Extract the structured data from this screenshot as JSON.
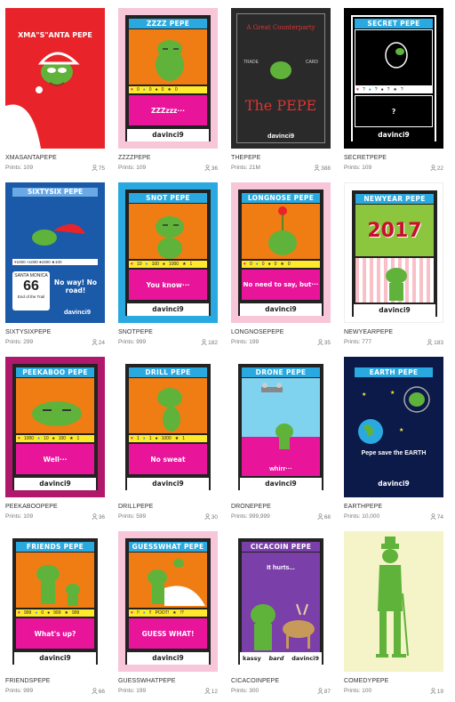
{
  "cards": [
    {
      "name": "XMASANTAPEPE",
      "prints": "Prints: 109",
      "owners": "75",
      "title": "XMA\"S\"ANTA PEPE",
      "desc": "",
      "stats": [],
      "footer": ""
    },
    {
      "name": "ZZZZPEPE",
      "prints": "Prints: 109",
      "owners": "36",
      "title": "ZZZZ PEPE",
      "desc": "ZZZzzz···",
      "stats": [
        "0",
        "0",
        "0",
        "0"
      ],
      "footer": "davinci9"
    },
    {
      "name": "THEPEPE",
      "prints": "Prints: 21M",
      "owners": "388",
      "title": "A Great Counterparty",
      "desc": "The PEPE",
      "stats": [
        "TRADE",
        "CARD"
      ],
      "footer": "davinci9"
    },
    {
      "name": "SECRETPEPE",
      "prints": "Prints: 109",
      "owners": "22",
      "title": "SECRET PEPE",
      "desc": "?",
      "stats": [
        "?",
        "?",
        "?",
        "?"
      ],
      "footer": "davinci9"
    },
    {
      "name": "SIXTYSIXPEPE",
      "prints": "Prints: 299",
      "owners": "24",
      "title": "SIXTYSIX PEPE",
      "desc": "No way! No road!",
      "stats": [
        "1000",
        "1000",
        "1000",
        "100"
      ],
      "footer": "davinci9",
      "sign_top": "SANTA MONICA",
      "sign_num": "66",
      "sign_bottom": "End of the Trail"
    },
    {
      "name": "SNOTPEPE",
      "prints": "Prints: 999",
      "owners": "182",
      "title": "SNOT PEPE",
      "desc": "You know···",
      "stats": [
        "10",
        "100",
        "1000",
        "1"
      ],
      "footer": "davinci9"
    },
    {
      "name": "LONGNOSEPEPE",
      "prints": "Prints: 199",
      "owners": "35",
      "title": "LONGNOSE PEPE",
      "desc": "No need to say, but···",
      "stats": [
        "0",
        "0",
        "0",
        "0"
      ],
      "footer": "davinci9"
    },
    {
      "name": "NEWYEARPEPE",
      "prints": "Prints: 777",
      "owners": "183",
      "title": "NEWYEAR PEPE",
      "desc": "2017",
      "stats": [],
      "footer": "davinci9"
    },
    {
      "name": "PEEKABOOPEPE",
      "prints": "Prints: 109",
      "owners": "36",
      "title": "PEEKABOO PEPE",
      "desc": "Well···",
      "stats": [
        "1000",
        "10",
        "100",
        "1"
      ],
      "footer": "davinci9"
    },
    {
      "name": "DRILLPEPE",
      "prints": "Prints: 599",
      "owners": "30",
      "title": "DRILL PEPE",
      "desc": "No sweat",
      "stats": [
        "1",
        "1",
        "1000",
        "1"
      ],
      "footer": "davinci9"
    },
    {
      "name": "DRONEPEPE",
      "prints": "Prints: 999,999",
      "owners": "68",
      "title": "DRONE PEPE",
      "desc": "whirr···",
      "stats": [],
      "footer": "davinci9"
    },
    {
      "name": "EARTHPEPE",
      "prints": "Prints: 10,000",
      "owners": "74",
      "title": "EARTH PEPE",
      "desc": "Pepe save the EARTH",
      "stats": [],
      "footer": "davinci9"
    },
    {
      "name": "FRIENDSPEPE",
      "prints": "Prints: 999",
      "owners": "66",
      "title": "FRIENDS PEPE",
      "desc": "What's up?",
      "stats": [
        "999",
        "0",
        "999",
        "999"
      ],
      "footer": "davinci9"
    },
    {
      "name": "GUESSWHATPEPE",
      "prints": "Prints: 199",
      "owners": "12",
      "title": "GUESSWHAT PEPE",
      "desc": "GUESS WHAT!",
      "stats": [
        "!!",
        "!!",
        "POOT!",
        "!?"
      ],
      "footer": "davinci9"
    },
    {
      "name": "CICACOINPEPE",
      "prints": "Prints: 300",
      "owners": "87",
      "title": "CICACOIN PEPE",
      "desc": "It hurts...",
      "stats": [],
      "footer": "davinci9",
      "credits": [
        "kassy",
        "bard"
      ]
    },
    {
      "name": "COMEDYPEPE",
      "prints": "Prints: 100",
      "owners": "19",
      "title": "",
      "desc": "",
      "stats": [],
      "footer": ""
    }
  ],
  "colors": {
    "orange": "#f07c14",
    "cyan": "#2aa9e0",
    "yellow": "#ffe92a",
    "magenta": "#e8149a",
    "frog": "#5fb33a"
  }
}
